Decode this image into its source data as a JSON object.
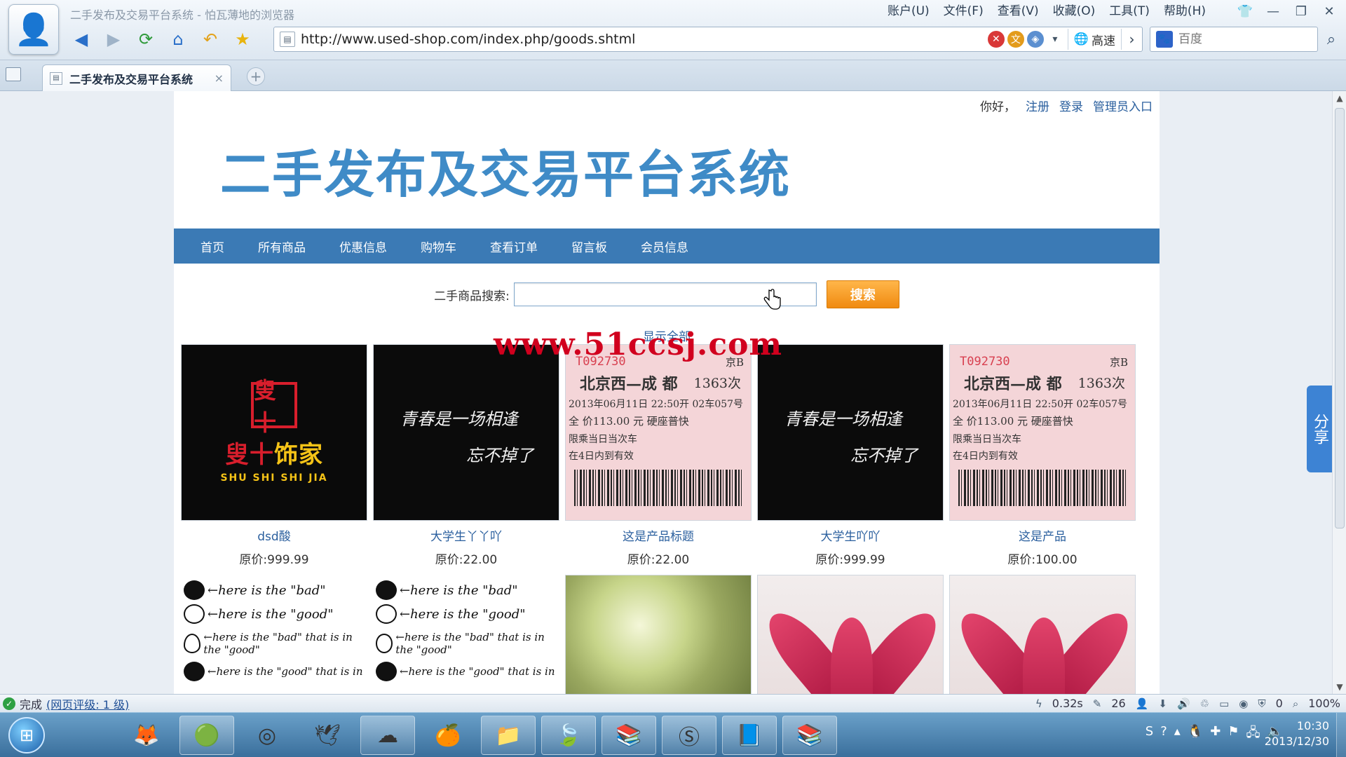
{
  "window": {
    "title": "二手发布及交易平台系统 - 怕瓦薄地的浏览器",
    "menu": [
      "账户(U)",
      "文件(F)",
      "查看(V)",
      "收藏(O)",
      "工具(T)",
      "帮助(H)"
    ]
  },
  "address_bar": {
    "url": "http://www.used-shop.com/index.php/goods.shtml",
    "speed_mode": "高速"
  },
  "search_box": {
    "engine": "百度"
  },
  "tab": {
    "title": "二手发布及交易平台系统",
    "close": "×",
    "new": "+"
  },
  "page": {
    "userbar": {
      "greeting": "你好，",
      "register": "注册",
      "login": "登录",
      "admin": "管理员入口"
    },
    "site_title": "二手发布及交易平台系统",
    "nav": [
      "首页",
      "所有商品",
      "优惠信息",
      "购物车",
      "查看订单",
      "留言板",
      "会员信息"
    ],
    "search": {
      "label": "二手商品搜索:",
      "button": "搜索",
      "value": ""
    },
    "show_all": "显示全部",
    "watermark": "www.51ccsj.com",
    "price_label": "原价:",
    "products": [
      {
        "name": "dsd酸",
        "price": "999.99",
        "image": "logo"
      },
      {
        "name": "大学生丫丫吖",
        "price": "22.00",
        "image": "black-text"
      },
      {
        "name": "这是产品标题",
        "price": "22.00",
        "image": "ticket"
      },
      {
        "name": "大学生吖吖",
        "price": "999.99",
        "image": "black-text"
      },
      {
        "name": "这是产品",
        "price": "100.00",
        "image": "ticket"
      }
    ],
    "image_text": {
      "logo_cn_1": "叟十",
      "logo_cn_2": "饰家",
      "logo_en": "SHU SHI SHI JIA",
      "black_line1": "青春是一场相逢",
      "black_line2": "忘不掉了",
      "ticket_no": "T092730",
      "ticket_mark": "京B",
      "ticket_route": "北京西—成 都",
      "ticket_train": "1363次",
      "ticket_date": "2013年06月11日 22:50开  02车057号",
      "ticket_price": "全 价113.00 元   硬座普快",
      "ticket_l1": "限乘当日当次车",
      "ticket_l2": "在4日内到有效",
      "note1": "←here is the \"bad\"",
      "note2": "←here is the \"good\"",
      "note3": "←here is the \"bad\" that is in the \"good\"",
      "note4": "←here is the \"good\" that is in"
    },
    "share": "分享"
  },
  "status": {
    "text": "完成",
    "rating": "(网页评级: 1 级)",
    "load_time": "0.32s",
    "count1": "26",
    "count2": "0",
    "zoom": "100%"
  },
  "taskbar": {
    "clock_time": "10:30",
    "clock_date": "2013/12/30"
  },
  "colors": {
    "nav_bg": "#3b7ab5",
    "title_blue": "#3f8bc7",
    "search_button": "#f08a10",
    "link": "#2a5f9e"
  }
}
